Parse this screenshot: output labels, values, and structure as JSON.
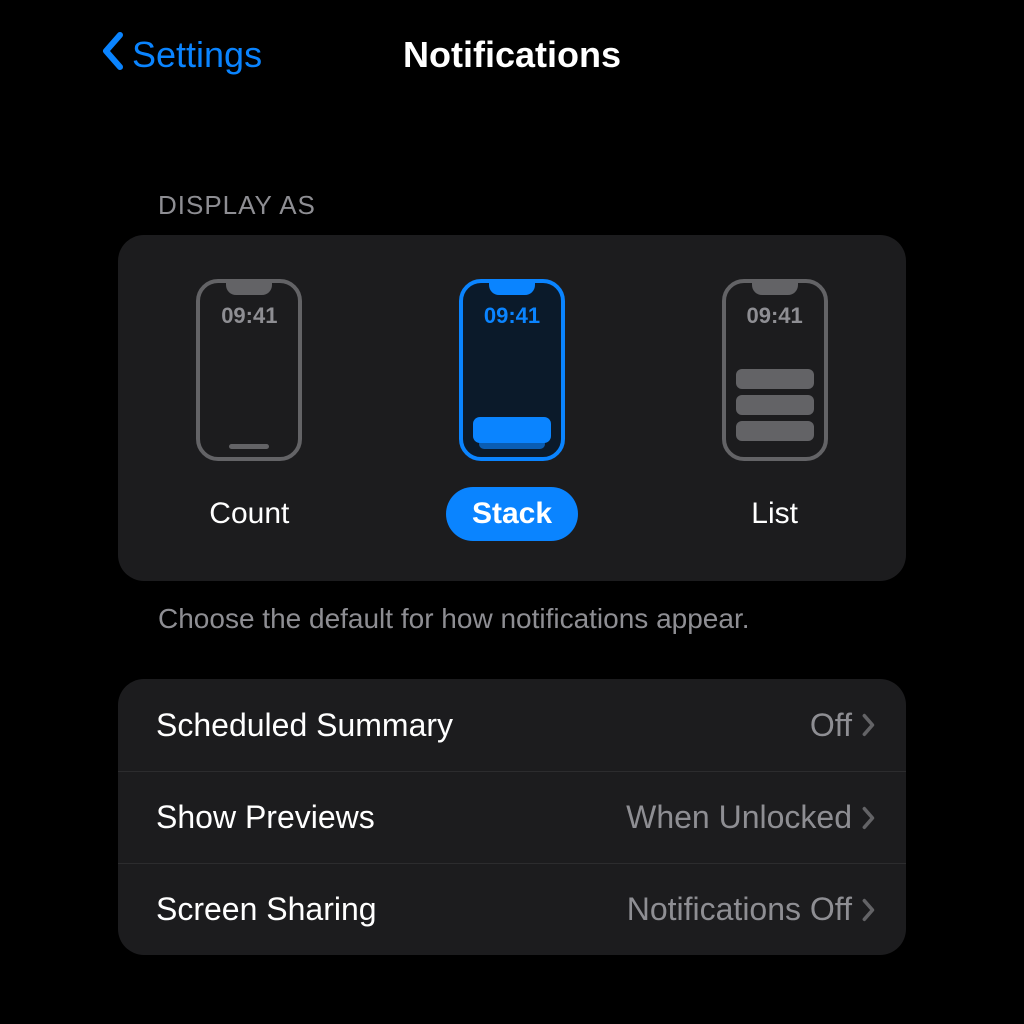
{
  "header": {
    "back_label": "Settings",
    "title": "Notifications"
  },
  "display_as": {
    "section_label": "DISPLAY AS",
    "phone_time": "09:41",
    "options": {
      "count": "Count",
      "stack": "Stack",
      "list": "List"
    },
    "selected": "stack",
    "footer": "Choose the default for how notifications appear."
  },
  "rows": {
    "scheduled_summary": {
      "label": "Scheduled Summary",
      "value": "Off"
    },
    "show_previews": {
      "label": "Show Previews",
      "value": "When Unlocked"
    },
    "screen_sharing": {
      "label": "Screen Sharing",
      "value": "Notifications Off"
    }
  },
  "colors": {
    "accent": "#0a84ff"
  }
}
